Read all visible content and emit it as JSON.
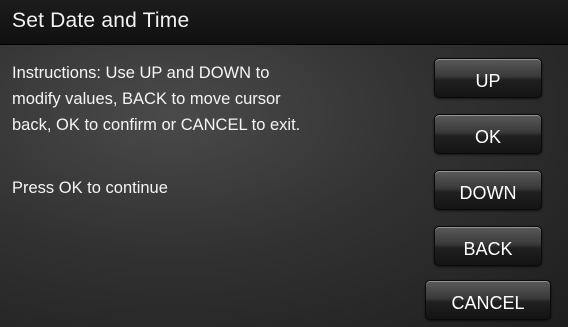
{
  "window": {
    "title": "Set Date and Time"
  },
  "content": {
    "instructions": "Instructions: Use UP and DOWN to\nmodify values, BACK to move cursor\nback, OK to confirm or CANCEL to exit.",
    "prompt": "Press OK to continue"
  },
  "buttons": {
    "up": "UP",
    "ok": "OK",
    "down": "DOWN",
    "back": "BACK",
    "cancel": "CANCEL"
  }
}
